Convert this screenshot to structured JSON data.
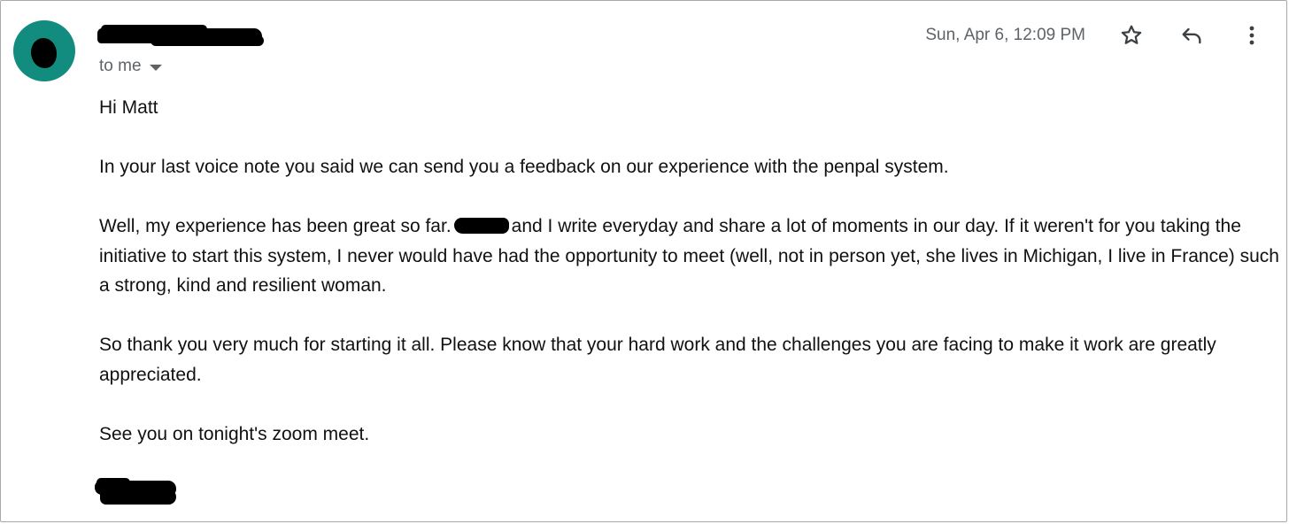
{
  "email": {
    "recipients_label": "to me",
    "timestamp": "Sun, Apr 6, 12:09 PM",
    "greeting": "Hi Matt",
    "paragraph_1": "In your last voice note you said we can send you a feedback on our experience with the penpal system.",
    "paragraph_2_before": "Well, my experience has been great so far.",
    "paragraph_2_after": "and I write everyday and share a lot of moments in our day. If it weren't for you taking the initiative to start this system, I never would have had the opportunity to meet (well, not in person yet, she lives in Michigan, I live in France) such a strong, kind and resilient woman.",
    "paragraph_3": "So thank you very much for starting it all. Please know that your hard work and the challenges you are facing to make it work are greatly appreciated.",
    "paragraph_4": "See you on tonight's zoom meet."
  },
  "icons": {
    "star": "star-icon",
    "reply": "reply-icon",
    "more": "more-vert-icon",
    "dropdown": "chevron-down-icon"
  },
  "colors": {
    "avatar": "#128c7e",
    "secondary_text": "#5f6368",
    "redaction": "#000000"
  }
}
